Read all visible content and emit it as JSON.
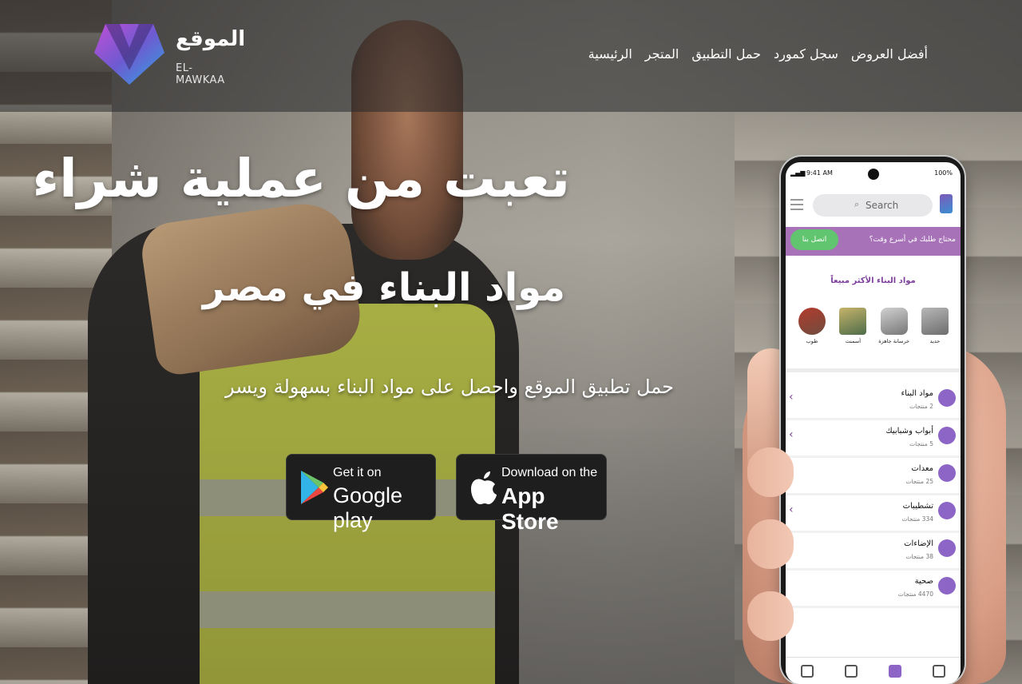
{
  "brand": {
    "name_ar": "الموقع",
    "name_en": "EL-MAWKAA"
  },
  "nav": {
    "items": [
      {
        "label": "الرئيسية"
      },
      {
        "label": "المتجر"
      },
      {
        "label": "حمل التطبيق"
      },
      {
        "label": "سجل كمورد"
      },
      {
        "label": "أفضل العروض"
      }
    ]
  },
  "hero": {
    "title": "تعبت من عملية شراء",
    "subtitle": "مواد البناء في مصر",
    "description": "حمل تطبيق الموقع واحصل على مواد البناء بسهولة ويسر"
  },
  "stores": {
    "google": {
      "small": "Get it on",
      "big": "Google play"
    },
    "apple": {
      "small": "Download on the",
      "big": "App Store"
    }
  },
  "phone": {
    "status": {
      "time": "9:41 AM",
      "battery": "100%"
    },
    "search_placeholder": "Search",
    "promo": {
      "text": "محتاج طلبك في أسرع وقت؟",
      "button": "اتصل بنا"
    },
    "section_title": "مواد البناء الأكثر مبيعاً",
    "categories": [
      {
        "label": "حديد"
      },
      {
        "label": "خرسانة جاهزة"
      },
      {
        "label": "أسمنت"
      },
      {
        "label": "طوب"
      }
    ],
    "list": [
      {
        "title": "مواد البناء",
        "count": "2 منتجات"
      },
      {
        "title": "أبواب وشبابيك",
        "count": "5 منتجات"
      },
      {
        "title": "معدات",
        "count": "25 منتجات"
      },
      {
        "title": "تشطيبات",
        "count": "334 منتجات"
      },
      {
        "title": "الإضاءات",
        "count": "38 منتجات"
      },
      {
        "title": "صحية",
        "count": "4470 منتجات"
      }
    ]
  },
  "colors": {
    "accent_purple": "#a772b8",
    "green_button": "#61c56f",
    "header_overlay": "#28282a"
  }
}
